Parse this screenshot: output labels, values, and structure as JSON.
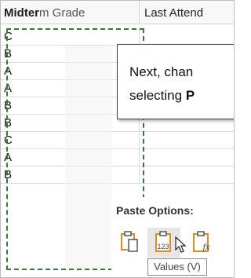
{
  "header": {
    "col_a_selected_part": "Midter",
    "col_a_rest": "m Grade",
    "col_b": "Last Attend"
  },
  "grades": [
    "C",
    "B",
    "A",
    "A",
    "B",
    "B",
    "C",
    "A",
    "B"
  ],
  "callout": {
    "line1": "Next, chan",
    "line2_prefix": "selecting ",
    "line2_bold": "P"
  },
  "paste_options": {
    "title": "Paste Options:",
    "buttons": [
      {
        "name": "paste",
        "icon": "clipboard-icon"
      },
      {
        "name": "paste-values",
        "icon": "clipboard-123-icon",
        "badge": "123"
      },
      {
        "name": "paste-formulas",
        "icon": "clipboard-fx-icon",
        "badge": "fx"
      }
    ],
    "tooltip": "Values (V)"
  },
  "colors": {
    "marquee": "#2e7d32",
    "icon_orange": "#e08a1e",
    "icon_outline": "#555555"
  }
}
